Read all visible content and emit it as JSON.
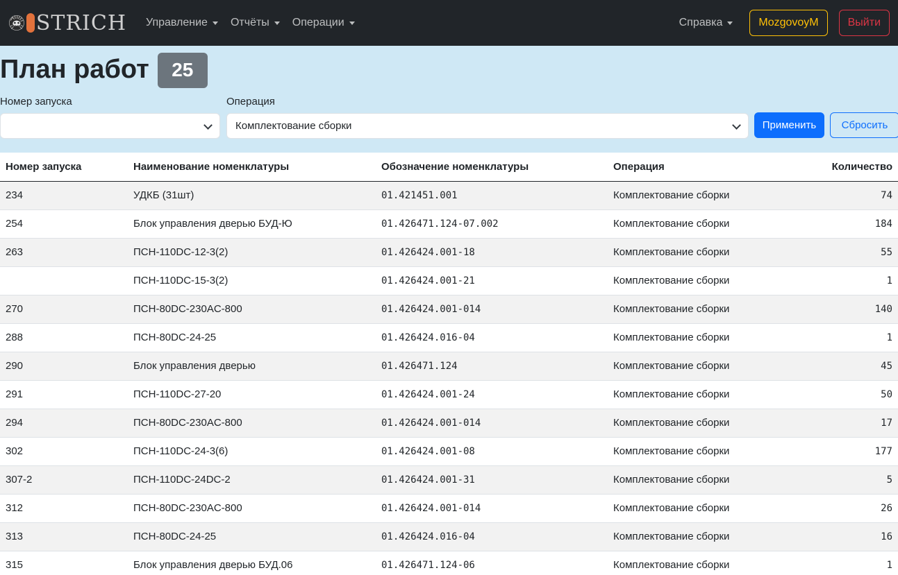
{
  "navbar": {
    "logo_text": "STRICH",
    "menu": [
      {
        "label": "Управление"
      },
      {
        "label": "Отчёты"
      },
      {
        "label": "Операции"
      }
    ],
    "help_label": "Справка",
    "user_label": "MozgovoyM",
    "logout_label": "Выйти"
  },
  "page": {
    "title": "План работ",
    "count": "25"
  },
  "filters": {
    "launch_label": "Номер запуска",
    "launch_value": "",
    "operation_label": "Операция",
    "operation_value": "Комплектование сборки",
    "apply_label": "Применить",
    "reset_label": "Сбросить"
  },
  "table": {
    "headers": [
      "Номер запуска",
      "Наименование номенклатуры",
      "Обозначение номенклатуры",
      "Операция",
      "Количество"
    ],
    "rows": [
      [
        "234",
        "УДКБ (31шт)",
        "01.421451.001",
        "Комплектование сборки",
        "74"
      ],
      [
        "254",
        "Блок управления дверью БУД-Ю",
        "01.426471.124-07.002",
        "Комплектование сборки",
        "184"
      ],
      [
        "263",
        "ПСН-110DC-12-3(2)",
        "01.426424.001-18",
        "Комплектование сборки",
        "55"
      ],
      [
        "",
        "ПСН-110DC-15-3(2)",
        "01.426424.001-21",
        "Комплектование сборки",
        "1"
      ],
      [
        "270",
        "ПСН-80DC-230AC-800",
        "01.426424.001-014",
        "Комплектование сборки",
        "140"
      ],
      [
        "288",
        "ПСН-80DC-24-25",
        "01.426424.016-04",
        "Комплектование сборки",
        "1"
      ],
      [
        "290",
        "Блок управления дверью",
        "01.426471.124",
        "Комплектование сборки",
        "45"
      ],
      [
        "291",
        "ПСН-110DC-27-20",
        "01.426424.001-24",
        "Комплектование сборки",
        "50"
      ],
      [
        "294",
        "ПСН-80DC-230AC-800",
        "01.426424.001-014",
        "Комплектование сборки",
        "17"
      ],
      [
        "302",
        "ПСН-110DC-24-3(6)",
        "01.426424.001-08",
        "Комплектование сборки",
        "177"
      ],
      [
        "307-2",
        "ПСН-110DC-24DC-2",
        "01.426424.001-31",
        "Комплектование сборки",
        "5"
      ],
      [
        "312",
        "ПСН-80DC-230AC-800",
        "01.426424.001-014",
        "Комплектование сборки",
        "26"
      ],
      [
        "313",
        "ПСН-80DC-24-25",
        "01.426424.016-04",
        "Комплектование сборки",
        "16"
      ],
      [
        "315",
        "Блок управления дверью БУД.06",
        "01.426471.124-06",
        "Комплектование сборки",
        "1"
      ]
    ]
  }
}
